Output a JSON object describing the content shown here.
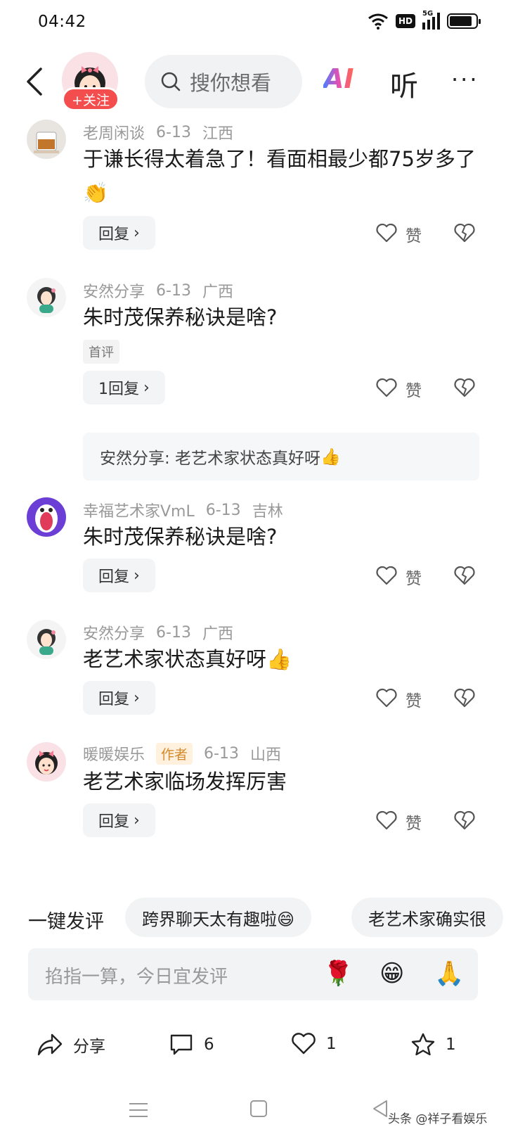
{
  "status": {
    "time": "04:42",
    "hd": "HD",
    "net": "5G"
  },
  "header": {
    "follow_label": "+关注",
    "search_placeholder": "搜你想看",
    "ai_label": "AI",
    "listen_label": "听",
    "more_label": "···"
  },
  "comments": [
    {
      "user": "老周闲谈",
      "date": "6-13",
      "region": "江西",
      "text": "于谦长得太着急了！看面相最少都75岁多了",
      "emoji": "👏",
      "reply_label": "回复",
      "like_label": "赞"
    },
    {
      "user": "安然分享",
      "date": "6-13",
      "region": "广西",
      "text": "朱时茂保养秘诀是啥?",
      "tag": "首评",
      "reply_label": "1回复",
      "like_label": "赞",
      "sub_reply": "安然分享: 老艺术家状态真好呀",
      "sub_emoji": "👍"
    },
    {
      "user": "幸福艺术家VmL",
      "date": "6-13",
      "region": "吉林",
      "text": "朱时茂保养秘诀是啥?",
      "reply_label": "回复",
      "like_label": "赞"
    },
    {
      "user": "安然分享",
      "date": "6-13",
      "region": "广西",
      "text": "老艺术家状态真好呀",
      "emoji": "👍",
      "reply_label": "回复",
      "like_label": "赞"
    },
    {
      "user": "暖暖娱乐",
      "author_tag": "作者",
      "date": "6-13",
      "region": "山西",
      "text": "老艺术家临场发挥厉害",
      "reply_label": "回复",
      "like_label": "赞"
    }
  ],
  "quick": {
    "label": "一键发评",
    "chips": [
      "跨界聊天太有趣啦😄",
      "老艺术家确实很"
    ]
  },
  "input": {
    "placeholder": "掐指一算，今日宜发评",
    "emojis": [
      "🌹",
      "😁",
      "🙏"
    ]
  },
  "actions": {
    "share": "分享",
    "comments": "6",
    "likes": "1",
    "favorites": "1"
  },
  "watermark": "头条 @祥子看娱乐"
}
